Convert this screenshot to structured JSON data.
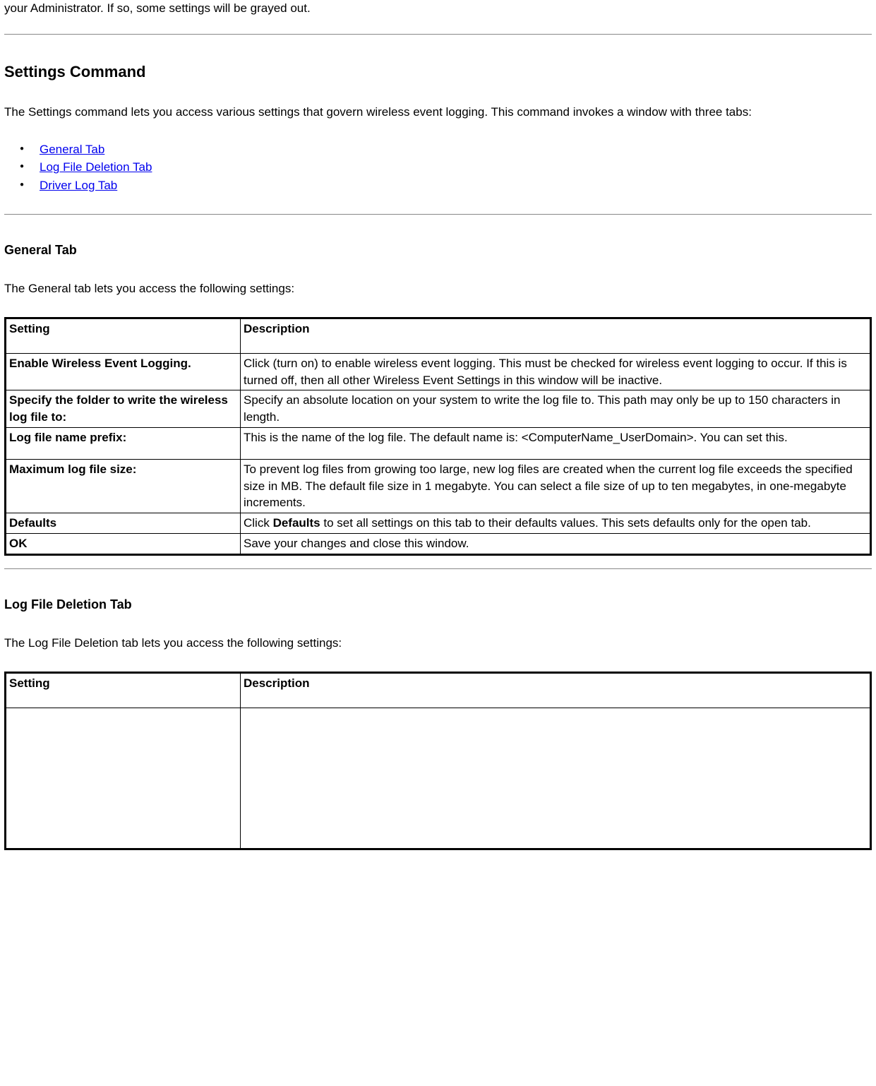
{
  "intro": "your Administrator. If so, some settings will be grayed out.",
  "settings_command": {
    "heading": "Settings Command",
    "paragraph": "The Settings command lets you access various settings that govern wireless event logging. This command invokes a window with three tabs:",
    "links": [
      "General Tab ",
      "Log File Deletion Tab",
      "Driver Log Tab"
    ]
  },
  "general_tab": {
    "heading": "General Tab",
    "paragraph": "The General tab lets you access the following settings:",
    "header_setting": "Setting",
    "header_description": "Description",
    "rows": [
      {
        "setting": "Enable Wireless Event Logging.",
        "description": "Click (turn on) to enable wireless event logging. This must be checked for wireless event logging to occur. If this is turned off, then all other Wireless Event Settings in this window will be inactive."
      },
      {
        "setting": "Specify the folder to write the wireless log file to:",
        "description": "Specify an absolute location on your system to write the log file to. This path may only be up to 150 characters in length."
      },
      {
        "setting": "Log file name prefix:",
        "description": "This is the name of the log file. The default name is: <ComputerName_UserDomain>. You can set this."
      },
      {
        "setting": "Maximum log file size:",
        "description": "To prevent log files from growing too large, new log files are created when the current log file exceeds the specified size in MB. The default file size in 1 megabyte. You can select a file size of up to ten megabytes, in one-megabyte increments."
      },
      {
        "setting": "Defaults",
        "description_pre": "Click ",
        "description_bold": "Defaults",
        "description_post": " to set all settings on this tab to their defaults values. This sets defaults only for the open tab."
      },
      {
        "setting": "OK",
        "description": "Save your changes and close this window."
      }
    ]
  },
  "log_file_deletion_tab": {
    "heading": "Log File Deletion Tab",
    "paragraph": "The Log File Deletion tab lets you access the following settings:",
    "header_setting": "Setting",
    "header_description": "Description"
  }
}
